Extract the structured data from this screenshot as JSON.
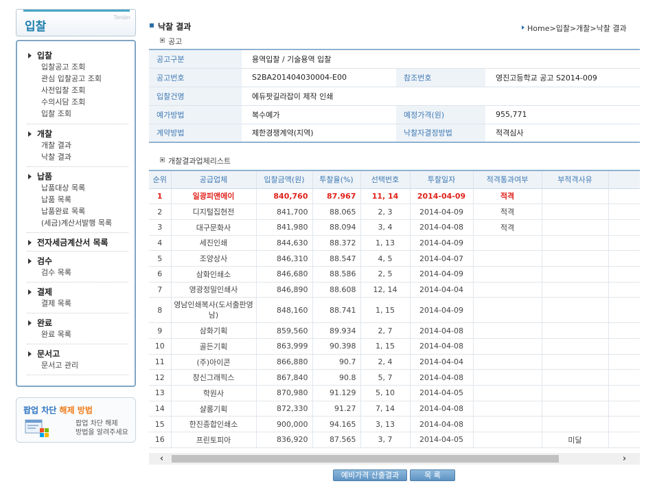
{
  "sidebar": {
    "title": "입찰",
    "subtitle": "Tender",
    "sections": [
      {
        "label": "입찰",
        "items": [
          "입찰공고 조회",
          "관심 입찰공고 조회",
          "사전입찰 조회",
          "수의시담 조회",
          "입찰 조회"
        ]
      },
      {
        "label": "개찰",
        "items": [
          "개찰 결과",
          "낙찰 결과"
        ]
      },
      {
        "label": "납품",
        "items": [
          "납품대상 목록",
          "납품 목록",
          "납품완료 목록",
          "(세금)계산서발행 목록"
        ]
      },
      {
        "label": "전자세금계산서 목록",
        "items": []
      },
      {
        "label": "검수",
        "items": [
          "검수 목록"
        ]
      },
      {
        "label": "결제",
        "items": [
          "결제 목록"
        ]
      },
      {
        "label": "완료",
        "items": [
          "완료 목록"
        ]
      },
      {
        "label": "문서고",
        "items": [
          "문서고 관리"
        ]
      }
    ],
    "popup_help": {
      "title_a": "팝업 차단 ",
      "title_b": "해제 방법",
      "desc_line1": "팝업 차단 해제",
      "desc_line2": "방법을 알려주세요"
    }
  },
  "header": {
    "title": "낙찰 결과",
    "section": "공고",
    "breadcrumb": "Home>입찰>개찰>낙찰 결과"
  },
  "info": {
    "rows": [
      [
        {
          "label": "공고구분",
          "value": "용역입찰 / 기술용역 입찰"
        }
      ],
      [
        {
          "label": "공고번호",
          "value": "S2BA201404030004-E00"
        },
        {
          "label": "참조번호",
          "value": "영진고등학교 공고 S2014-009"
        }
      ],
      [
        {
          "label": "입찰건명",
          "value": "에듀팟길라잡이 제작 인쇄"
        }
      ],
      [
        {
          "label": "예가방법",
          "value": "복수예가"
        },
        {
          "label": "예정가격(원)",
          "value": "955,771"
        }
      ],
      [
        {
          "label": "계약방법",
          "value": "제한경쟁계약(지역)"
        },
        {
          "label": "낙찰자결정방법",
          "value": "적격심사"
        }
      ]
    ]
  },
  "results": {
    "label": "개찰결과업체리스트",
    "columns": [
      "순위",
      "공급업체",
      "입찰금액(원)",
      "투찰율(%)",
      "선택번호",
      "투찰일자",
      "적격통과여부",
      "부적격사유",
      ""
    ],
    "rows": [
      {
        "rank": "1",
        "vendor": "일광피앤에이",
        "amount": "840,760",
        "rate": "87.967",
        "numbers": "11, 14",
        "date": "2014-04-09",
        "pass": "적격",
        "reason": "",
        "winner": true
      },
      {
        "rank": "2",
        "vendor": "디지털집현전",
        "amount": "841,700",
        "rate": "88.065",
        "numbers": "2, 3",
        "date": "2014-04-09",
        "pass": "적격",
        "reason": ""
      },
      {
        "rank": "3",
        "vendor": "대구문화사",
        "amount": "841,980",
        "rate": "88.094",
        "numbers": "3, 4",
        "date": "2014-04-08",
        "pass": "적격",
        "reason": ""
      },
      {
        "rank": "4",
        "vendor": "세진인쇄",
        "amount": "844,630",
        "rate": "88.372",
        "numbers": "1, 13",
        "date": "2014-04-09",
        "pass": "",
        "reason": ""
      },
      {
        "rank": "5",
        "vendor": "조양상사",
        "amount": "846,310",
        "rate": "88.547",
        "numbers": "4, 5",
        "date": "2014-04-07",
        "pass": "",
        "reason": ""
      },
      {
        "rank": "6",
        "vendor": "삼화인쇄소",
        "amount": "846,680",
        "rate": "88.586",
        "numbers": "2, 5",
        "date": "2014-04-09",
        "pass": "",
        "reason": ""
      },
      {
        "rank": "7",
        "vendor": "영광정밀인쇄사",
        "amount": "846,890",
        "rate": "88.608",
        "numbers": "12, 14",
        "date": "2014-04-04",
        "pass": "",
        "reason": ""
      },
      {
        "rank": "8",
        "vendor": "영남인쇄복사(도서출판영남)",
        "amount": "848,160",
        "rate": "88.741",
        "numbers": "1, 15",
        "date": "2014-04-09",
        "pass": "",
        "reason": "",
        "tall": true
      },
      {
        "rank": "9",
        "vendor": "삼화기획",
        "amount": "859,560",
        "rate": "89.934",
        "numbers": "2, 7",
        "date": "2014-04-08",
        "pass": "",
        "reason": ""
      },
      {
        "rank": "10",
        "vendor": "골든기획",
        "amount": "863,999",
        "rate": "90.398",
        "numbers": "1, 15",
        "date": "2014-04-08",
        "pass": "",
        "reason": ""
      },
      {
        "rank": "11",
        "vendor": "(주)아이콘",
        "amount": "866,880",
        "rate": "90.7",
        "numbers": "2, 4",
        "date": "2014-04-04",
        "pass": "",
        "reason": ""
      },
      {
        "rank": "12",
        "vendor": "창신그래픽스",
        "amount": "867,840",
        "rate": "90.8",
        "numbers": "5, 7",
        "date": "2014-04-08",
        "pass": "",
        "reason": ""
      },
      {
        "rank": "13",
        "vendor": "학원사",
        "amount": "870,980",
        "rate": "91.129",
        "numbers": "5, 10",
        "date": "2014-04-05",
        "pass": "",
        "reason": ""
      },
      {
        "rank": "14",
        "vendor": "샬롬기획",
        "amount": "872,330",
        "rate": "91.27",
        "numbers": "7, 14",
        "date": "2014-04-08",
        "pass": "",
        "reason": ""
      },
      {
        "rank": "15",
        "vendor": "한진종합인쇄소",
        "amount": "900,000",
        "rate": "94.165",
        "numbers": "3, 13",
        "date": "2014-04-08",
        "pass": "",
        "reason": ""
      },
      {
        "rank": "16",
        "vendor": "프린토피아",
        "amount": "836,920",
        "rate": "87.565",
        "numbers": "3, 7",
        "date": "2014-04-05",
        "pass": "",
        "reason": "미달"
      }
    ]
  },
  "scrollbar": {
    "left_icon": "chevron-left-icon",
    "right_icon": "chevron-right-icon"
  },
  "buttons": {
    "calc_label": "예비가격 산출결과",
    "list_label": "목 록"
  },
  "colors": {
    "accent": "#3f79b3",
    "winner": "#e0221a",
    "label_bg": "#eef3f8",
    "popup_orange": "#f07d1c"
  }
}
